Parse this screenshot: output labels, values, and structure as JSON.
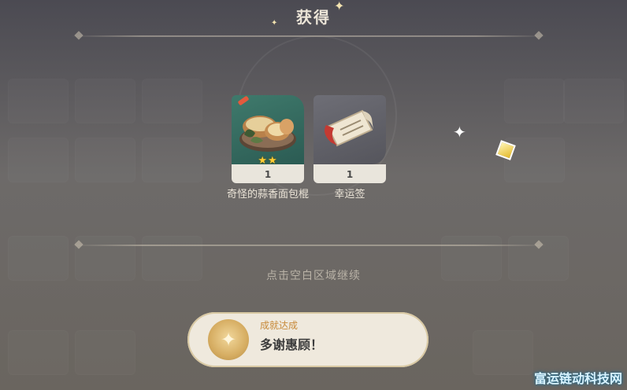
{
  "dialog": {
    "title": "获得",
    "items": [
      {
        "name": "奇怪的蒜香面包棍",
        "count": "1",
        "stars": "★★",
        "icon": "garlic-bread-icon"
      },
      {
        "name": "幸运签",
        "count": "1",
        "stars": "",
        "icon": "scroll-icon"
      }
    ],
    "hint": "点击空白区域继续"
  },
  "achievement": {
    "label": "成就达成",
    "title": "多谢惠顾！",
    "icon": "achievement-medal-icon"
  },
  "watermark": "富运链动科技网",
  "colors": {
    "four_star_bg": "#3f7a6c",
    "one_star_bg": "#6e6e76",
    "card_footer": "#e9e5dc",
    "achievement_label": "#c78a3a"
  }
}
